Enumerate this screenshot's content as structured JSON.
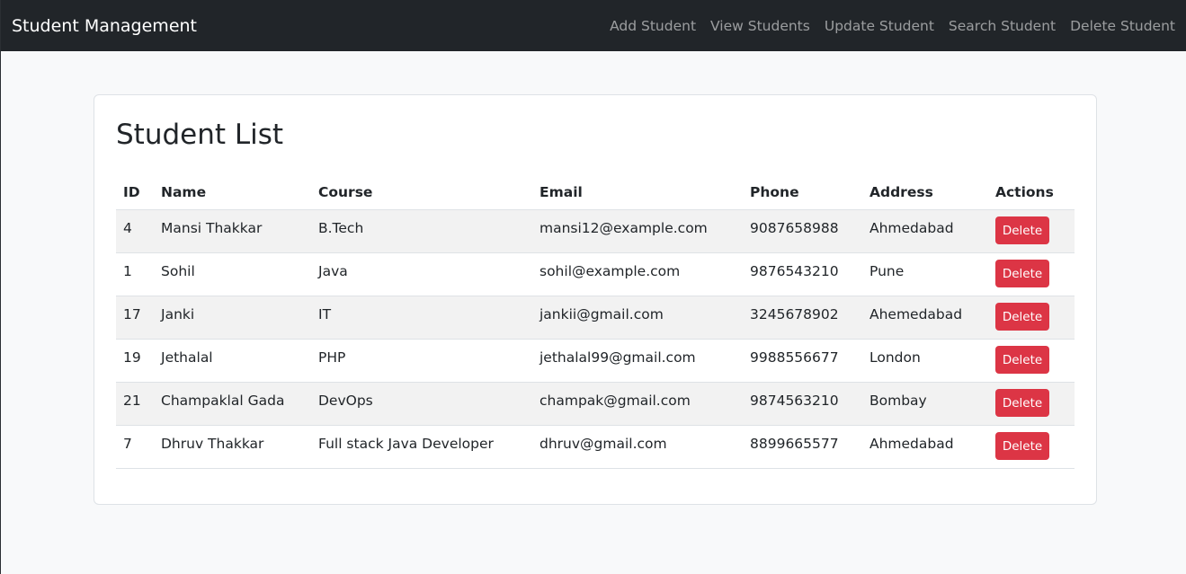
{
  "navbar": {
    "brand": "Student Management",
    "links": [
      "Add Student",
      "View Students",
      "Update Student",
      "Search Student",
      "Delete Student"
    ]
  },
  "page": {
    "title": "Student List"
  },
  "table": {
    "headers": [
      "ID",
      "Name",
      "Course",
      "Email",
      "Phone",
      "Address",
      "Actions"
    ],
    "delete_label": "Delete",
    "rows": [
      {
        "id": "4",
        "name": "Mansi Thakkar",
        "course": "B.Tech",
        "email": "mansi12@example.com",
        "phone": "9087658988",
        "address": "Ahmedabad"
      },
      {
        "id": "1",
        "name": "Sohil",
        "course": "Java",
        "email": "sohil@example.com",
        "phone": "9876543210",
        "address": "Pune"
      },
      {
        "id": "17",
        "name": "Janki",
        "course": "IT",
        "email": "jankii@gmail.com",
        "phone": "3245678902",
        "address": "Ahemedabad"
      },
      {
        "id": "19",
        "name": "Jethalal",
        "course": "PHP",
        "email": "jethalal99@gmail.com",
        "phone": "9988556677",
        "address": "London"
      },
      {
        "id": "21",
        "name": "Champaklal Gada",
        "course": "DevOps",
        "email": "champak@gmail.com",
        "phone": "9874563210",
        "address": "Bombay"
      },
      {
        "id": "7",
        "name": "Dhruv Thakkar",
        "course": "Full stack Java Developer",
        "email": "dhruv@gmail.com",
        "phone": "8899665577",
        "address": "Ahmedabad"
      }
    ]
  },
  "colors": {
    "navbar_bg": "#212529",
    "danger": "#dc3545",
    "page_bg": "#f8f9fa"
  }
}
